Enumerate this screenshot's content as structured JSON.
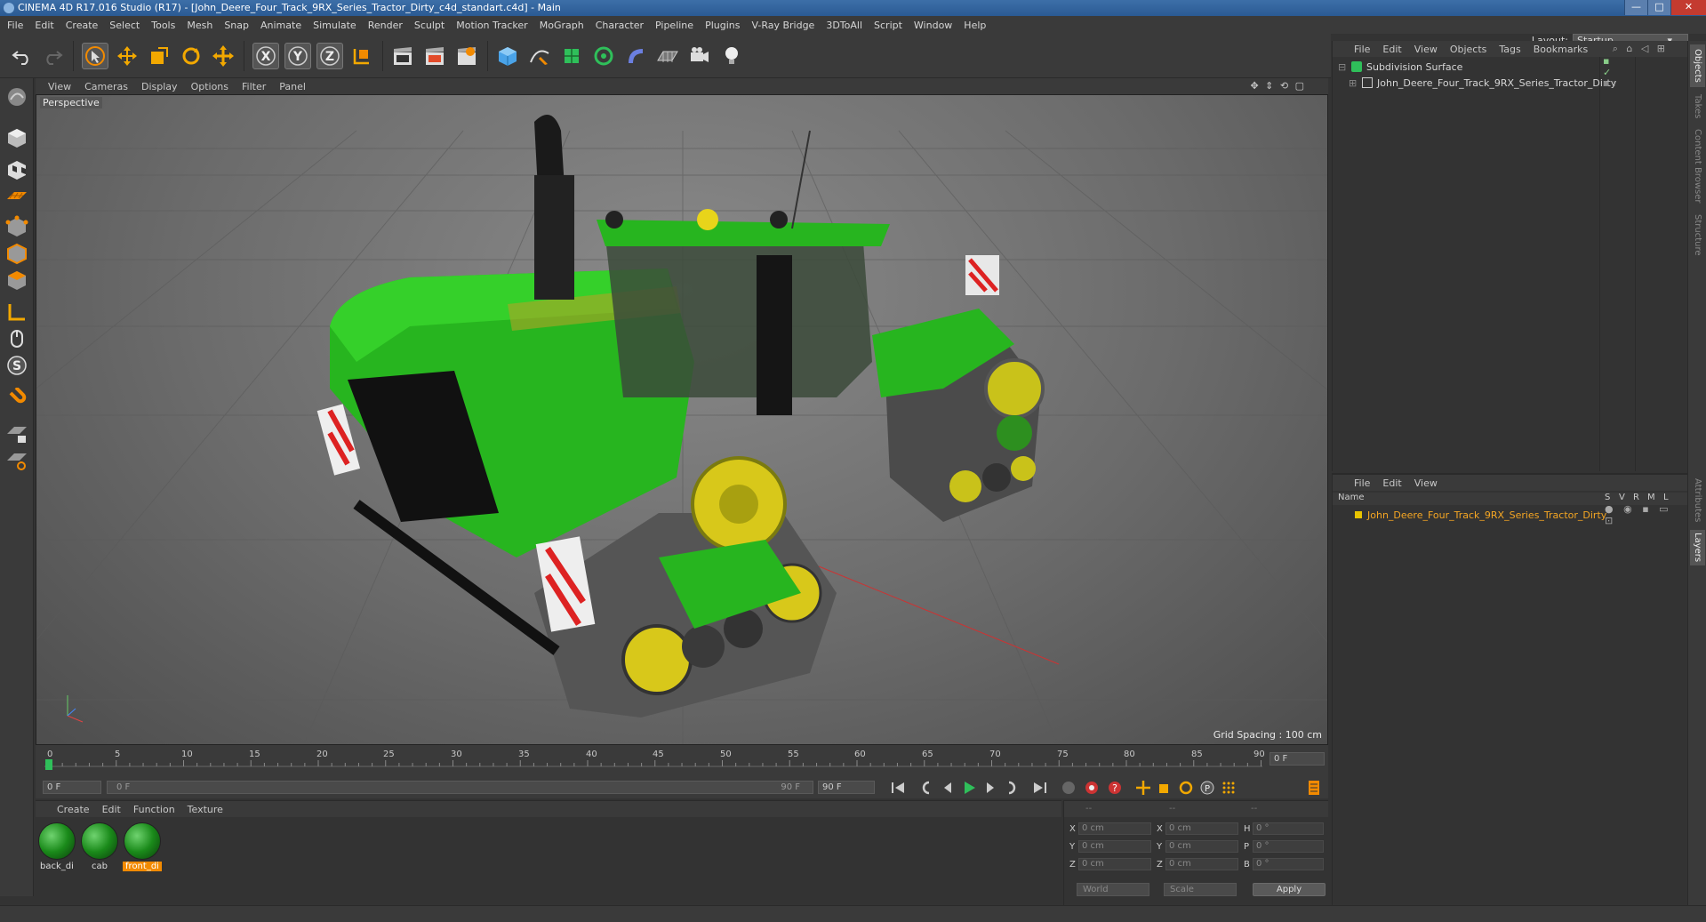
{
  "window": {
    "title": "CINEMA 4D R17.016 Studio (R17) - [John_Deere_Four_Track_9RX_Series_Tractor_Dirty_c4d_standart.c4d] - Main",
    "controls": [
      "—",
      "□",
      "✕"
    ]
  },
  "menubar": {
    "items": [
      "File",
      "Edit",
      "Create",
      "Select",
      "Tools",
      "Mesh",
      "Snap",
      "Animate",
      "Simulate",
      "Render",
      "Sculpt",
      "Motion Tracker",
      "MoGraph",
      "Character",
      "Pipeline",
      "Plugins",
      "V-Ray Bridge",
      "3DToAll",
      "Script",
      "Window",
      "Help"
    ],
    "layout_label": "Layout:",
    "layout_value": "Startup"
  },
  "viewport": {
    "menu": [
      "View",
      "Cameras",
      "Display",
      "Options",
      "Filter",
      "Panel"
    ],
    "camera_label": "Perspective",
    "grid_spacing": "Grid Spacing : 100 cm",
    "nav_icons": "✥ ⇕ ⟲ ▢"
  },
  "timeline": {
    "ticks": [
      "0",
      "5",
      "10",
      "15",
      "20",
      "25",
      "30",
      "35",
      "40",
      "45",
      "50",
      "55",
      "60",
      "65",
      "70",
      "75",
      "80",
      "85",
      "90"
    ],
    "current_frame": "0 F",
    "start_field": "0 F",
    "slider_start": "0 F",
    "slider_end": "90 F",
    "end_field": "90 F"
  },
  "materials": {
    "menu": [
      "Create",
      "Edit",
      "Function",
      "Texture"
    ],
    "items": [
      {
        "name": "back_di",
        "active": false
      },
      {
        "name": "cab",
        "active": false
      },
      {
        "name": "front_di",
        "active": true
      }
    ]
  },
  "coordinates": {
    "head": [
      "--",
      "--",
      "--"
    ],
    "rows": [
      {
        "a1": "X",
        "v1": "0 cm",
        "a2": "X",
        "v2": "0 cm",
        "a3": "H",
        "v3": "0 °"
      },
      {
        "a1": "Y",
        "v1": "0 cm",
        "a2": "Y",
        "v2": "0 cm",
        "a3": "P",
        "v3": "0 °"
      },
      {
        "a1": "Z",
        "v1": "0 cm",
        "a2": "Z",
        "v2": "0 cm",
        "a3": "B",
        "v3": "0 °"
      }
    ],
    "world": "World",
    "scale": "Scale",
    "apply": "Apply"
  },
  "object_manager": {
    "menu": [
      "File",
      "Edit",
      "View",
      "Objects",
      "Tags",
      "Bookmarks"
    ],
    "objects": [
      {
        "name": "Subdivision Surface",
        "indent": 0
      },
      {
        "name": "John_Deere_Four_Track_9RX_Series_Tractor_Dirty",
        "indent": 1
      }
    ]
  },
  "layer_manager": {
    "menu": [
      "File",
      "Edit",
      "View"
    ],
    "columns": [
      "Name",
      "S",
      "V",
      "R",
      "M",
      "L"
    ],
    "layers": [
      {
        "name": "John_Deere_Four_Track_9RX_Series_Tractor_Dirty",
        "color": "#e8c400"
      }
    ]
  },
  "side_tabs": [
    "Objects",
    "Takes",
    "Content Browser",
    "Structure",
    "Attributes",
    "Layers"
  ],
  "colors": {
    "accent": "#f28a00",
    "tractor_green": "#27b51f",
    "wheel_yellow": "#d8c81a"
  }
}
